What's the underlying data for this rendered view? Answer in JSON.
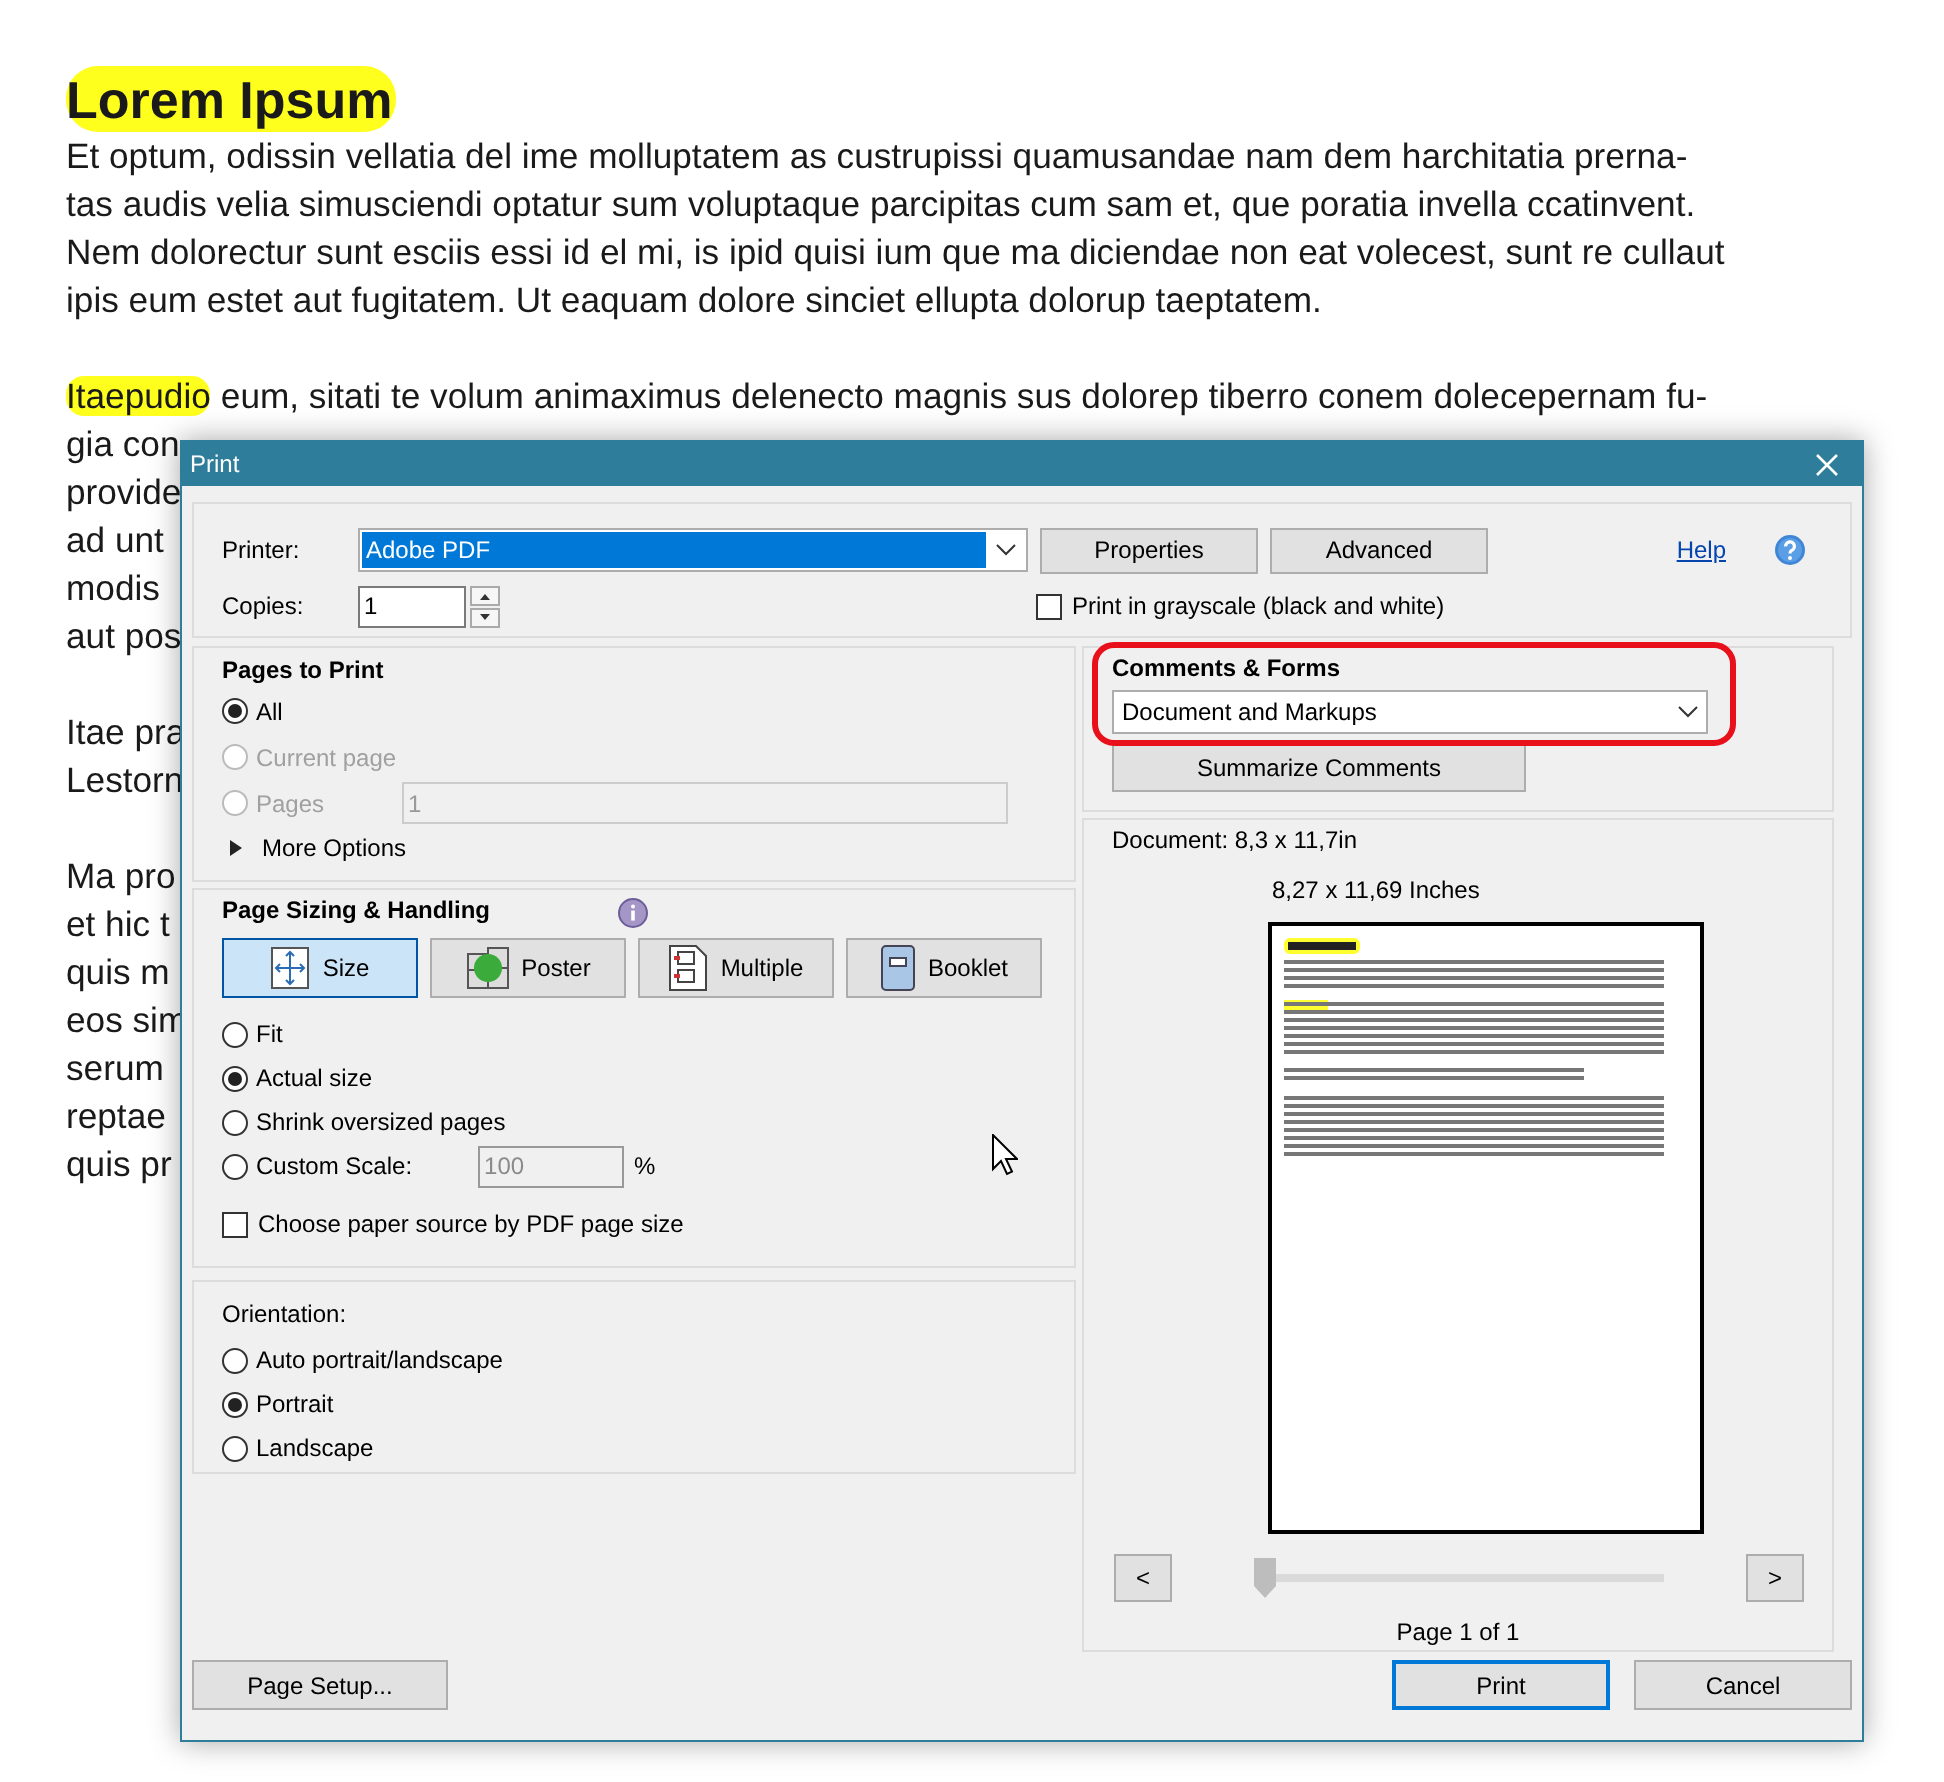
{
  "document": {
    "title": "Lorem Ipsum",
    "paragraphs": [
      {
        "lines": [
          {
            "text": "Et optum, odissin vellatia del ime molluptatem as custrupissi quamusandae nam dem harchitatia prerna-"
          },
          {
            "text": "tas audis velia simusciendi optatur sum voluptaque parcipitas cum sam et, que poratia invella ccatinvent."
          },
          {
            "text": "Nem dolorectur sunt esciis essi id el mi, is ipid quisi ium que ma diciendae non eat volecest, sunt re cullaut"
          },
          {
            "text": "ipis eum estet aut fugitatem. Ut eaquam dolore sinciet ellupta dolorup taeptatem."
          }
        ]
      },
      {
        "lines": [
          {
            "lead": "Itaepudio",
            "text": "eum, sitati te volum animaximus delenecto magnis sus dolorep tiberro conem dolecepernam fu-"
          },
          {
            "text": "gia con"
          },
          {
            "text": "provide"
          },
          {
            "text": "ad unt"
          },
          {
            "text": "modis"
          },
          {
            "text": "aut pos"
          }
        ]
      },
      {
        "lines": [
          {
            "text": "Itae pra"
          },
          {
            "text": "Lestorn"
          }
        ]
      },
      {
        "lines": [
          {
            "text": "Ma pro"
          },
          {
            "text": "et hic t"
          },
          {
            "text": "quis m"
          },
          {
            "text": "eos sim"
          },
          {
            "text": "serum"
          },
          {
            "text": "reptae"
          },
          {
            "text": "quis pr"
          }
        ]
      }
    ]
  },
  "dialog": {
    "title": "Print",
    "printer": {
      "label": "Printer:",
      "value": "Adobe PDF"
    },
    "top_buttons": [
      "Properties",
      "Advanced"
    ],
    "help": "Help",
    "copies": {
      "label": "Copies:",
      "value": "1"
    },
    "grayscale": {
      "label": "Print in grayscale (black and white)",
      "checked": false
    },
    "pages_to_print": {
      "title": "Pages to Print",
      "options": [
        {
          "label": "All",
          "selected": true,
          "disabled": false
        },
        {
          "label": "Current page",
          "selected": false,
          "disabled": true
        },
        {
          "label": "Pages",
          "selected": false,
          "disabled": true
        }
      ],
      "pages_value": "1",
      "more_options": "More Options"
    },
    "page_sizing": {
      "title": "Page Sizing & Handling",
      "modes": [
        {
          "kind": "size",
          "label": "Size",
          "selected": true
        },
        {
          "kind": "poster",
          "label": "Poster",
          "selected": false
        },
        {
          "kind": "multiple",
          "label": "Multiple",
          "selected": false
        },
        {
          "kind": "booklet",
          "label": "Booklet",
          "selected": false
        }
      ],
      "options": [
        {
          "label": "Fit",
          "selected": false
        },
        {
          "label": "Actual size",
          "selected": true
        },
        {
          "label": "Shrink oversized pages",
          "selected": false
        },
        {
          "label": "Custom Scale:",
          "selected": false
        }
      ],
      "scale_value": "100",
      "scale_unit": "%",
      "paper_source": {
        "label": "Choose paper source by PDF page size",
        "checked": false
      }
    },
    "orientation": {
      "title": "Orientation:",
      "options": [
        {
          "label": "Auto portrait/landscape",
          "selected": false
        },
        {
          "label": "Portrait",
          "selected": true
        },
        {
          "label": "Landscape",
          "selected": false
        }
      ]
    },
    "comments_forms": {
      "title": "Comments & Forms",
      "value": "Document and Markups",
      "summarize": "Summarize Comments"
    },
    "preview": {
      "document_size": "Document: 8,3 x 11,7in",
      "paper_size": "8,27 x 11,69 Inches",
      "prev": "<",
      "next": ">",
      "level": 0,
      "page_label": "Page 1 of 1"
    },
    "footer": {
      "page_setup": "Page Setup...",
      "print": "Print",
      "cancel": "Cancel"
    }
  }
}
